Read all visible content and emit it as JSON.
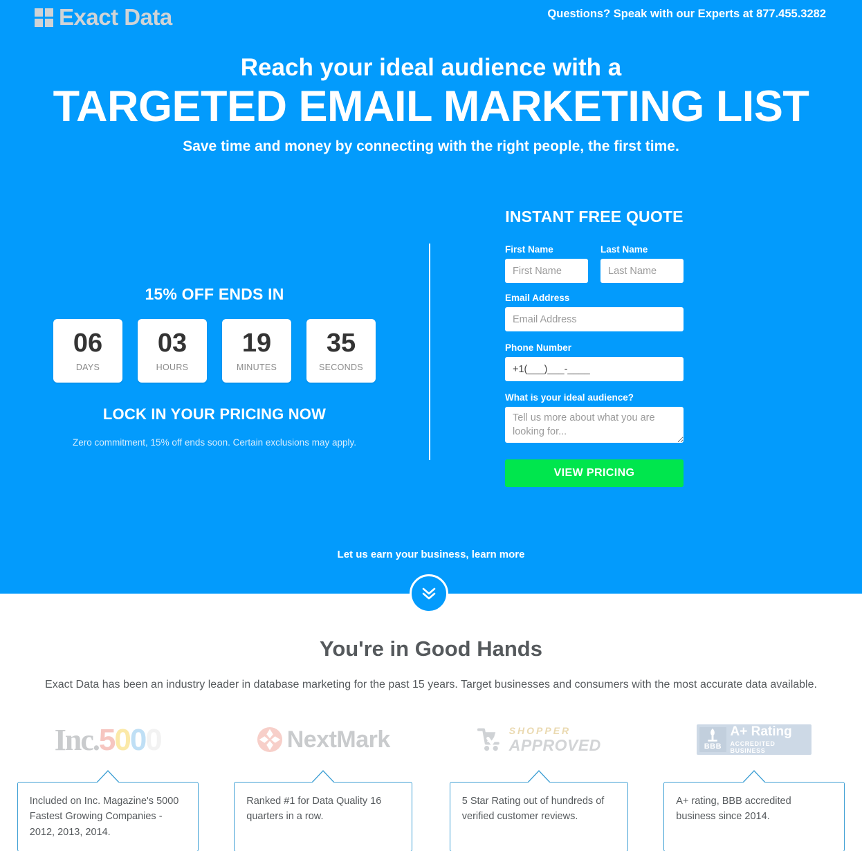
{
  "header": {
    "logo_text": "Exact Data",
    "logo_icon": "grid-squares-icon",
    "contact_lead": "Questions? Speak with our Experts at ",
    "contact_phone": "877.455.3282"
  },
  "hero": {
    "line1": "Reach your ideal audience with a",
    "line2": "TARGETED EMAIL MARKETING LIST",
    "subtitle": "Save time and money by connecting with the right people, the first time."
  },
  "offer": {
    "title": "15% OFF ENDS IN",
    "timer": [
      {
        "value": "06",
        "label": "DAYS"
      },
      {
        "value": "03",
        "label": "HOURS"
      },
      {
        "value": "19",
        "label": "MINUTES"
      },
      {
        "value": "35",
        "label": "SECONDS"
      }
    ],
    "lock_title": "LOCK IN YOUR PRICING NOW",
    "lock_sub": "Zero commitment, 15% off ends soon. Certain exclusions may apply."
  },
  "form": {
    "title": "INSTANT FREE QUOTE",
    "first_name": {
      "label": "First Name",
      "placeholder": "First Name",
      "value": ""
    },
    "last_name": {
      "label": "Last Name",
      "placeholder": "Last Name",
      "value": ""
    },
    "email": {
      "label": "Email Address",
      "placeholder": "Email Address",
      "value": ""
    },
    "phone": {
      "label": "Phone Number",
      "placeholder": "+1(___)___-____",
      "value": "+1(___)___-____"
    },
    "audience": {
      "label": "What is your ideal audience?",
      "placeholder": "Tell us more about what you are looking for...",
      "value": ""
    },
    "submit_label": "VIEW PRICING",
    "submit_color": "#00e64d"
  },
  "scroll": {
    "note": "Let us earn your business, learn more",
    "icon": "double-chevron-down-icon"
  },
  "trust": {
    "title": "You're in Good Hands",
    "description": "Exact Data has been an industry leader in database marketing for the past 15 years. Target businesses and consumers with the most accurate data available.",
    "badges": [
      {
        "logo_name": "inc-5000-logo",
        "logo_word": "Inc.",
        "logo_digits": [
          "5",
          "0",
          "0",
          "0"
        ],
        "caption": "Included on Inc. Magazine's 5000 Fastest Growing Companies - 2012, 2013, 2014."
      },
      {
        "logo_name": "nextmark-logo",
        "logo_word": "NextMark",
        "caption": "Ranked #1 for Data Quality 16 quarters in a row."
      },
      {
        "logo_name": "shopper-approved-logo",
        "logo_top": "SHOPPER",
        "logo_bottom": "APPROVED",
        "caption": "5 Star Rating out of hundreds of verified customer reviews."
      },
      {
        "logo_name": "bbb-a-plus-rating-logo",
        "logo_letters": "BBB",
        "logo_rating": "A+ Rating",
        "logo_accredited": "ACCREDITED BUSINESS",
        "caption": "A+ rating, BBB accredited business since 2014."
      }
    ]
  },
  "colors": {
    "hero_blue": "#039bfc",
    "cta_green": "#00e64d",
    "callout_border": "#3e9fd4",
    "body_text": "#55595c"
  }
}
